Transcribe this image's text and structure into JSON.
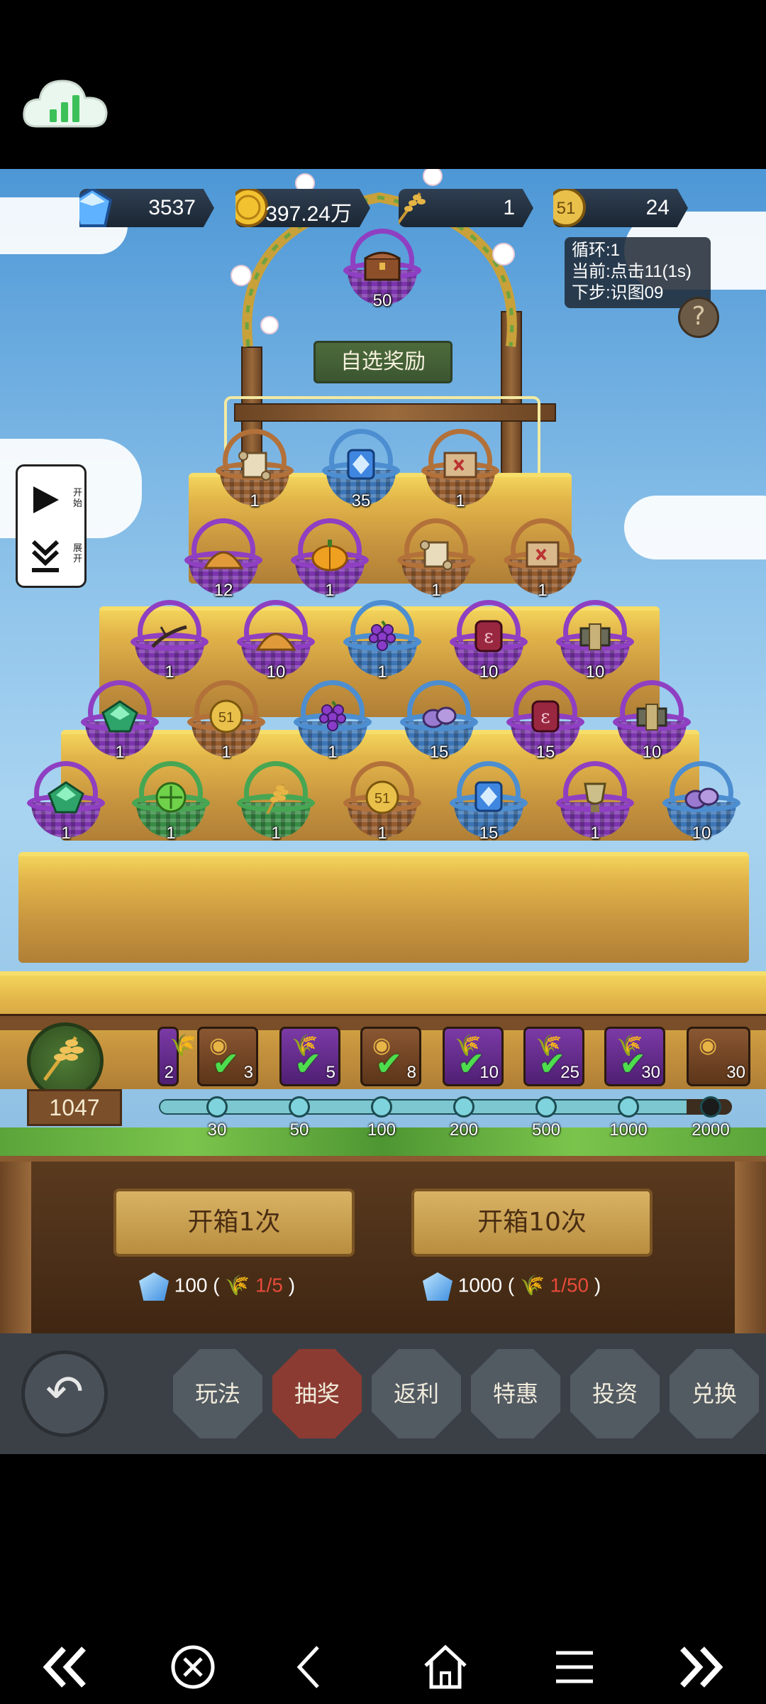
{
  "currencies": [
    {
      "name": "gems",
      "value": "3537"
    },
    {
      "name": "gold",
      "value": "397.24万"
    },
    {
      "name": "wheat",
      "value": "1"
    },
    {
      "name": "coin-51",
      "value": "24"
    }
  ],
  "script_info": {
    "line1": "循环:1",
    "line2": "当前:点击11(1s)",
    "line3": "下步:识图09"
  },
  "side_panel": {
    "start": "开始",
    "expand": "展开"
  },
  "top_reward": {
    "count": "50"
  },
  "select_label": "自选奖励",
  "pyramid": [
    [
      {
        "color": "brown",
        "icon": "scroll",
        "count": "1"
      },
      {
        "color": "blue",
        "icon": "blue-tile",
        "count": "35"
      },
      {
        "color": "brown",
        "icon": "map",
        "count": "1"
      }
    ],
    [
      {
        "color": "purple",
        "icon": "sand-pile",
        "count": "12"
      },
      {
        "color": "purple",
        "icon": "pumpkin",
        "count": "1"
      },
      {
        "color": "brown",
        "icon": "scroll",
        "count": "1"
      },
      {
        "color": "brown",
        "icon": "map",
        "count": "1"
      }
    ],
    [
      {
        "color": "purple",
        "icon": "branch",
        "count": "1"
      },
      {
        "color": "purple",
        "icon": "sand-pile",
        "count": "10"
      },
      {
        "color": "blue",
        "icon": "grapes",
        "count": "1"
      },
      {
        "color": "purple",
        "icon": "rune-stone",
        "count": "10"
      },
      {
        "color": "purple",
        "icon": "banner",
        "count": "10"
      }
    ],
    [
      {
        "color": "purple",
        "icon": "green-gem",
        "count": "1"
      },
      {
        "color": "brown",
        "icon": "coin-51",
        "count": "1"
      },
      {
        "color": "blue",
        "icon": "grapes",
        "count": "1"
      },
      {
        "color": "blue",
        "icon": "purple-ore",
        "count": "15"
      },
      {
        "color": "purple",
        "icon": "rune-stone",
        "count": "15"
      },
      {
        "color": "purple",
        "icon": "banner",
        "count": "10"
      }
    ],
    [
      {
        "color": "purple",
        "icon": "green-gem",
        "count": "1"
      },
      {
        "color": "green",
        "icon": "green-orb",
        "count": "1"
      },
      {
        "color": "green",
        "icon": "wheat",
        "count": "1"
      },
      {
        "color": "brown",
        "icon": "coin-51",
        "count": "1"
      },
      {
        "color": "blue",
        "icon": "blue-tile",
        "count": "15"
      },
      {
        "color": "purple",
        "icon": "trophy",
        "count": "1"
      },
      {
        "color": "blue",
        "icon": "purple-ore",
        "count": "10"
      }
    ]
  ],
  "wheat_total": "1047",
  "milestone_rewards": [
    {
      "style": "purple",
      "count": "2"
    },
    {
      "style": "brown",
      "count": "3"
    },
    {
      "style": "purple",
      "count": "5"
    },
    {
      "style": "brown",
      "count": "8"
    },
    {
      "style": "purple",
      "count": "10"
    },
    {
      "style": "purple",
      "count": "25"
    },
    {
      "style": "purple",
      "count": "30"
    },
    {
      "style": "brown",
      "count": "30"
    }
  ],
  "milestones": [
    "30",
    "50",
    "100",
    "200",
    "500",
    "1000",
    "2000"
  ],
  "open_once": {
    "label": "开箱1次",
    "gem_cost": "100",
    "progress_open": " (",
    "wheat_progress": "1/5",
    "progress_close": ")"
  },
  "open_ten": {
    "label": "开箱10次",
    "gem_cost": "1000",
    "progress_open": " (",
    "wheat_progress": "1/50",
    "progress_close": ")"
  },
  "nav": {
    "back": "↶",
    "items": [
      "玩法",
      "抽奖",
      "返利",
      "特惠",
      "投资",
      "兑换"
    ],
    "active": "抽奖"
  },
  "colors": {
    "hay": "#e2b54a",
    "sky": "#8ec3ea",
    "active_tab": "#8c3b32",
    "check": "#4ddd4d"
  }
}
